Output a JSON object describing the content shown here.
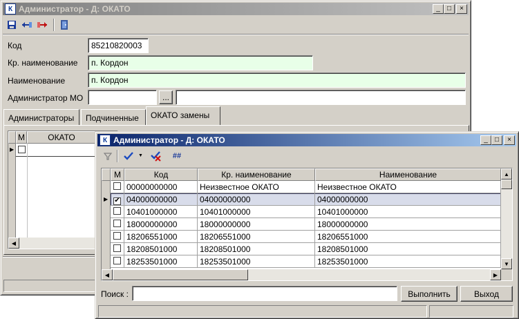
{
  "back_window": {
    "title": "Администратор - Д: ОКАТО",
    "form": {
      "code_label": "Код",
      "code_value": "85210820003",
      "short_name_label": "Кр. наименование",
      "short_name_value": "п. Кордон",
      "name_label": "Наименование",
      "name_value": "п. Кордон",
      "admin_mo_label": "Администратор МО",
      "admin_mo_button": "..."
    },
    "tabs": [
      "Администраторы",
      "Подчиненные",
      "ОКАТО замены"
    ],
    "grid": {
      "col_m": "М",
      "col_okato": "ОКАТО"
    }
  },
  "front_window": {
    "title": "Администратор - Д: ОКАТО",
    "toolbar": {
      "numbering": "##"
    },
    "grid": {
      "columns": [
        "М",
        "Код",
        "Кр. наименование",
        "Наименование"
      ],
      "rows": [
        {
          "checked": false,
          "code": "00000000000",
          "short": "Неизвестное ОКАТО",
          "name": "Неизвестное ОКАТО",
          "selected": false
        },
        {
          "checked": true,
          "code": "04000000000",
          "short": "04000000000",
          "name": "04000000000",
          "selected": true
        },
        {
          "checked": false,
          "code": "10401000000",
          "short": "10401000000",
          "name": "10401000000",
          "selected": false
        },
        {
          "checked": false,
          "code": "18000000000",
          "short": "18000000000",
          "name": "18000000000",
          "selected": false
        },
        {
          "checked": false,
          "code": "18206551000",
          "short": "18206551000",
          "name": "18206551000",
          "selected": false
        },
        {
          "checked": false,
          "code": "18208501000",
          "short": "18208501000",
          "name": "18208501000",
          "selected": false
        },
        {
          "checked": false,
          "code": "18253501000",
          "short": "18253501000",
          "name": "18253501000",
          "selected": false
        }
      ]
    },
    "search": {
      "label": "Поиск :",
      "value": "",
      "execute_button": "Выполнить",
      "exit_button": "Выход"
    }
  }
}
